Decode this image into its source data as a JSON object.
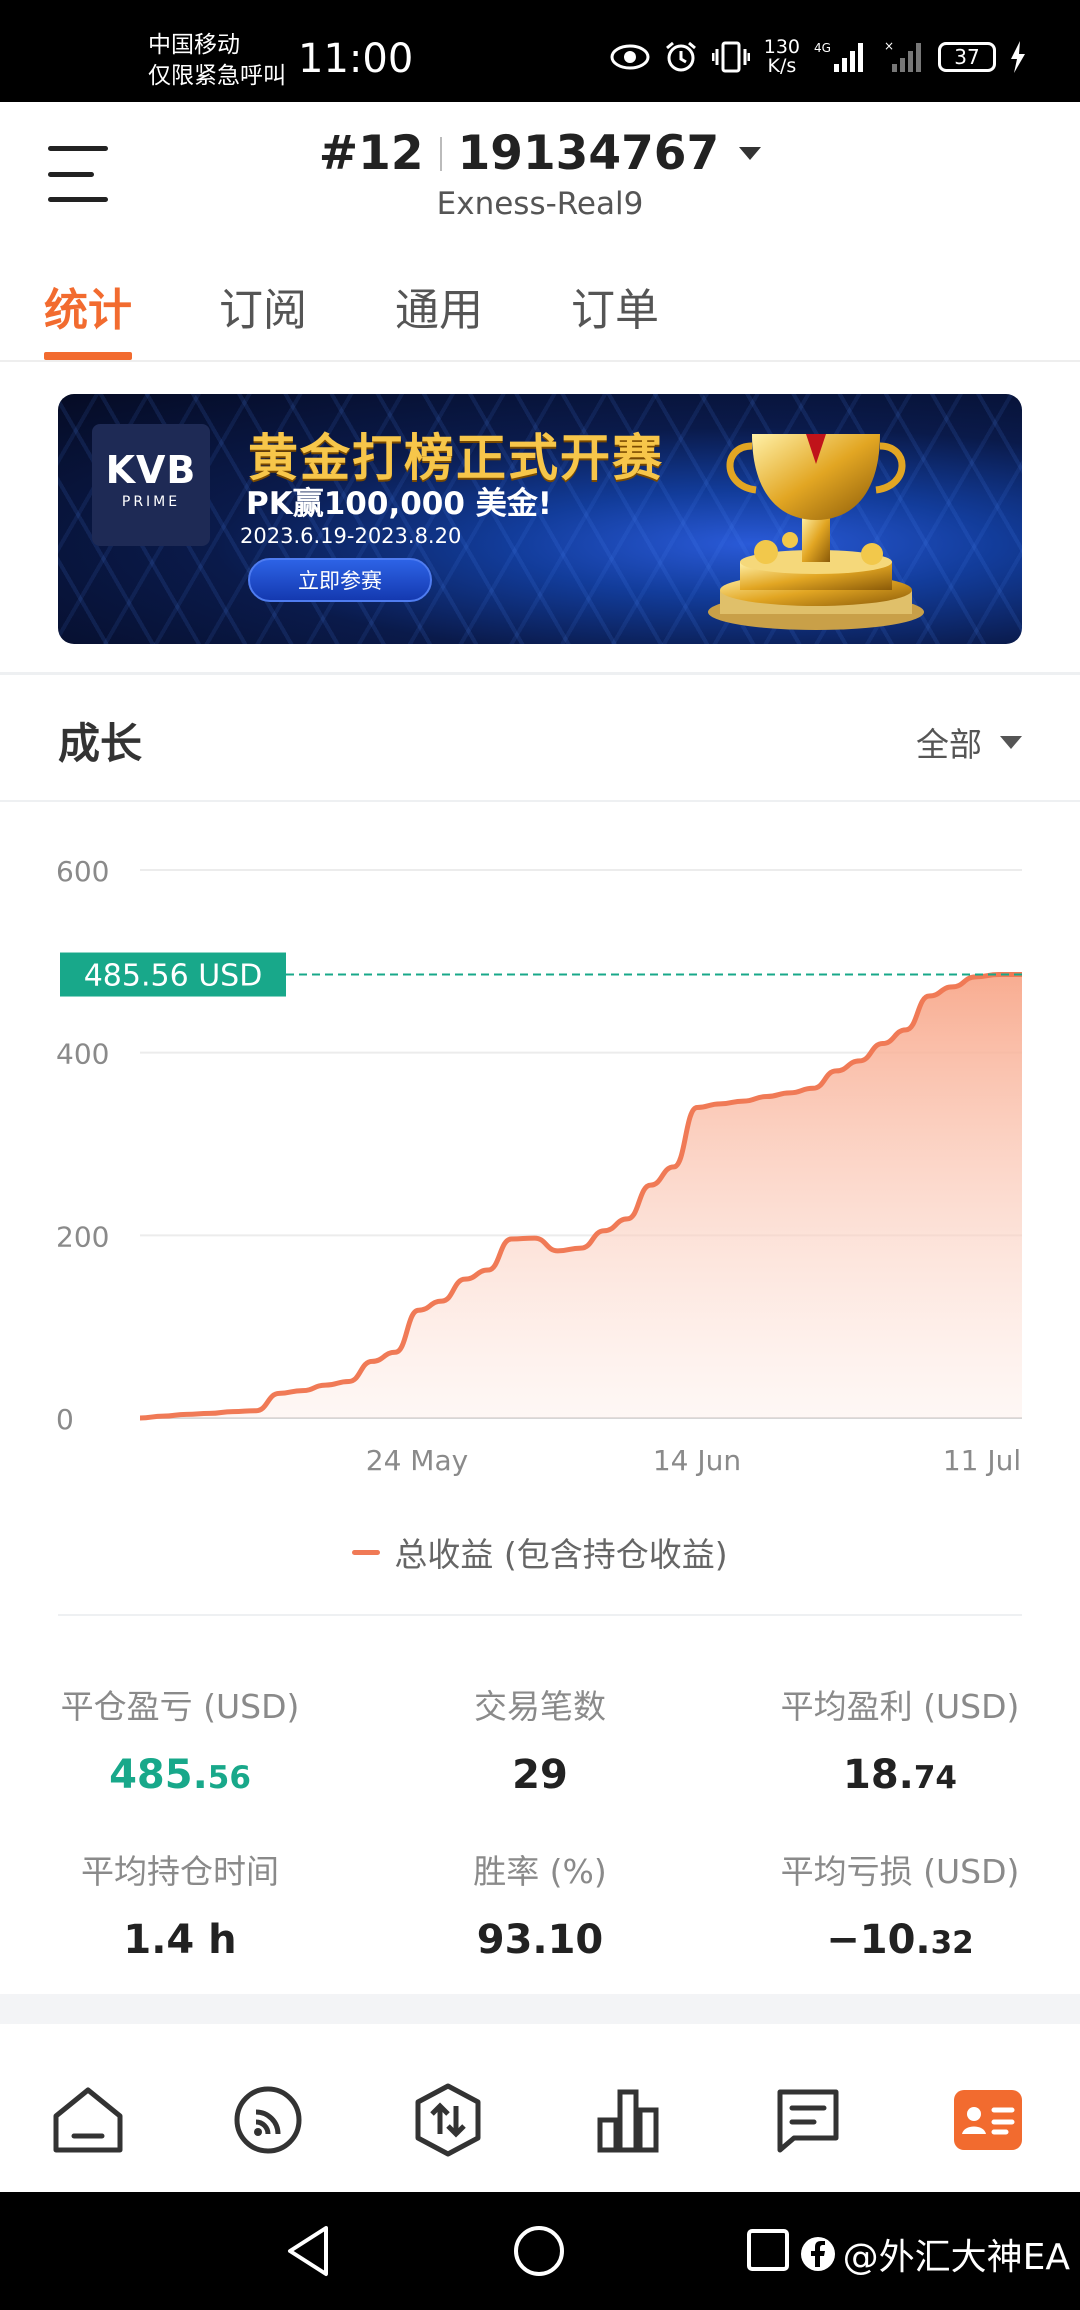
{
  "status_bar": {
    "carrier_line1": "中国移动",
    "carrier_line2": "仅限紧急呼叫",
    "time": "11:00",
    "net_speed_value": "130",
    "net_speed_unit": "K/s",
    "network": "4G",
    "battery": "37"
  },
  "header": {
    "account_prefix": "#12",
    "account_number": "19134767",
    "server": "Exness-Real9"
  },
  "tabs": [
    {
      "label": "统计",
      "active": true
    },
    {
      "label": "订阅",
      "active": false
    },
    {
      "label": "通用",
      "active": false
    },
    {
      "label": "订单",
      "active": false
    }
  ],
  "banner": {
    "logo_main": "KVB",
    "logo_sub": "PRIME",
    "title": "黄金打榜正式开赛",
    "subtitle": "PK赢100,000 美金!",
    "date_range": "2023.6.19-2023.8.20",
    "cta": "立即参赛"
  },
  "growth": {
    "title": "成长",
    "range": "全部"
  },
  "chart_data": {
    "type": "area",
    "title": "",
    "xlabel": "",
    "ylabel": "",
    "ylim": [
      0,
      600
    ],
    "yticks": [
      0,
      200,
      400,
      600
    ],
    "xtick_labels": [
      "24 May",
      "14 Jun",
      "11 Jul"
    ],
    "current_value_label": "485.56 USD",
    "current_value": 485.56,
    "legend_placement": "bottom",
    "grid": true,
    "series": [
      {
        "name": "总收益 (包含持仓收益)",
        "color": "#f07a56",
        "values": [
          0,
          2,
          4,
          5,
          7,
          8,
          27,
          30,
          36,
          40,
          62,
          72,
          118,
          128,
          152,
          162,
          196,
          197,
          183,
          186,
          205,
          218,
          255,
          275,
          340,
          344,
          347,
          352,
          356,
          361,
          380,
          391,
          410,
          425,
          462,
          472,
          483,
          485.56,
          485.56
        ]
      }
    ]
  },
  "stats": [
    {
      "label": "平仓盈亏 (USD)",
      "int": "485.",
      "dec": "56",
      "green": true
    },
    {
      "label": "交易笔数",
      "int": "29",
      "dec": "",
      "green": false
    },
    {
      "label": "平均盈利 (USD)",
      "int": "18.",
      "dec": "74",
      "green": false
    },
    {
      "label": "平均持仓时间",
      "int": "1.4 h",
      "dec": "",
      "green": false
    },
    {
      "label": "胜率 (%)",
      "int": "93.10",
      "dec": "",
      "green": false
    },
    {
      "label": "平均亏损 (USD)",
      "int": "−10.",
      "dec": "32",
      "green": false
    }
  ],
  "bottom_nav": [
    {
      "icon": "home-icon"
    },
    {
      "icon": "signal-feed-icon"
    },
    {
      "icon": "trade-icon"
    },
    {
      "icon": "chart-bars-icon"
    },
    {
      "icon": "message-icon"
    },
    {
      "icon": "profile-card-icon",
      "active": true
    }
  ],
  "watermark": "@外汇大神EA",
  "colors": {
    "accent": "#f26b2f",
    "positive": "#18a88a",
    "series": "#f07a56"
  }
}
